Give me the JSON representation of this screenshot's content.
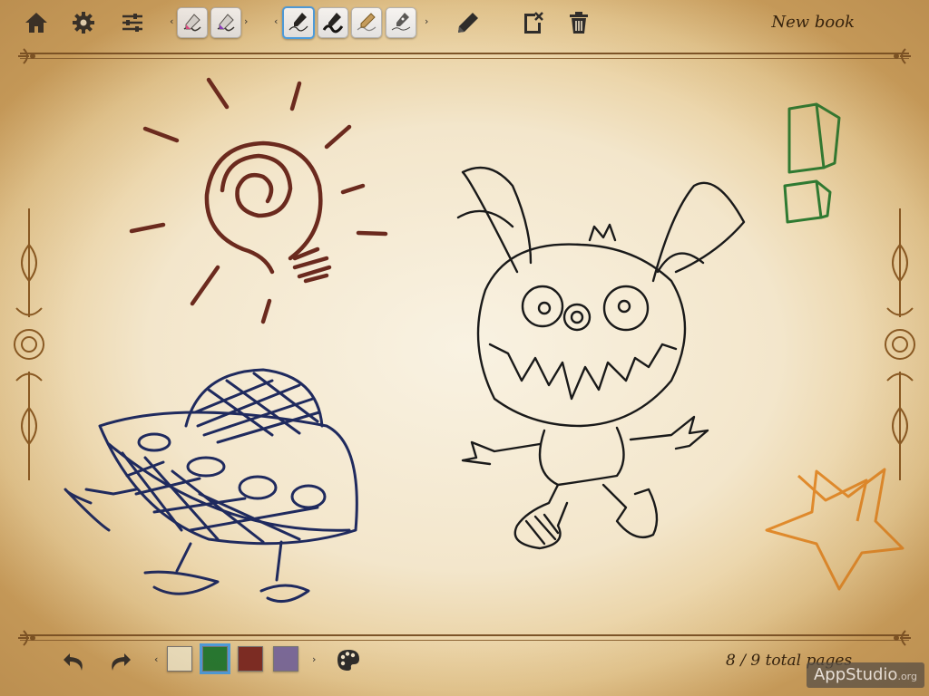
{
  "toolbar": {
    "book_title": "New book",
    "buttons": {
      "home": "home-icon",
      "settings": "gear-icon",
      "adjust": "sliders-icon",
      "edit": "pencil-icon",
      "clear_page": "clear-page-icon",
      "delete": "trash-icon"
    },
    "scroll_left": "‹",
    "scroll_right": "›"
  },
  "bottom": {
    "undo": "undo-icon",
    "redo": "redo-icon",
    "palette": "palette-icon",
    "scroll_left": "‹",
    "scroll_right": "›",
    "colors": [
      "#f2e8c8",
      "#217a32",
      "#7c2a24",
      "#7a6a9c"
    ],
    "selected_color": "#217a32",
    "page_count": "8 / 9 total pages"
  },
  "watermark": {
    "main": "AppStudio",
    "suffix": ".org"
  },
  "ink": {
    "brown": "#6b2a1e",
    "blue": "#1f2a5e",
    "black": "#1a1a1a",
    "green": "#2f7a32",
    "orange": "#e08a2c"
  }
}
